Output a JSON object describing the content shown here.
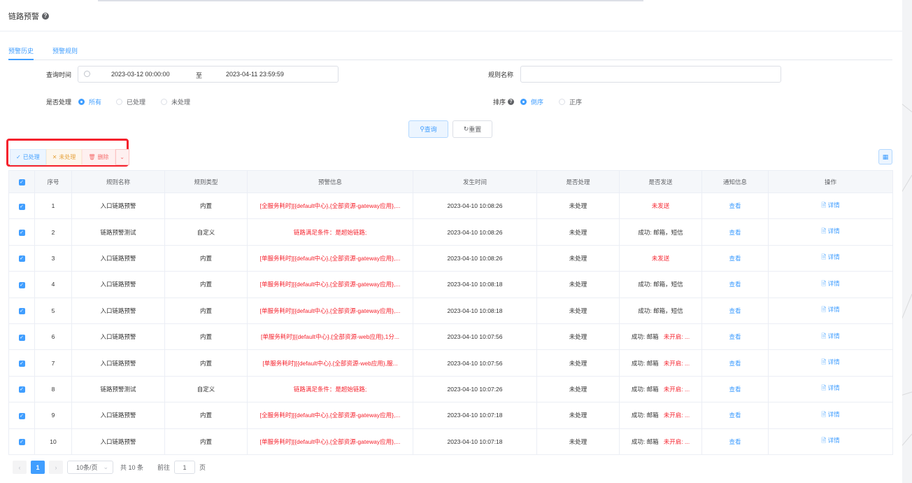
{
  "page": {
    "title": "链路预警"
  },
  "tabs": [
    {
      "label": "预警历史",
      "active": true
    },
    {
      "label": "预警规则",
      "active": false
    }
  ],
  "filters": {
    "time_label": "查询时间",
    "start": "2023-03-12 00:00:00",
    "separator": "至",
    "end": "2023-04-11 23:59:59",
    "rule_name_label": "规则名称",
    "rule_name_value": "",
    "processed_label": "是否处理",
    "processed_options": [
      "所有",
      "已处理",
      "未处理"
    ],
    "processed_selected": "所有",
    "sort_label": "排序",
    "sort_options": [
      "倒序",
      "正序"
    ],
    "sort_selected": "倒序"
  },
  "buttons": {
    "query": "查询",
    "reset": "重置"
  },
  "actions": {
    "processed": "已处理",
    "unprocessed": "未处理",
    "delete": "删除"
  },
  "columns": [
    "序号",
    "规则名称",
    "规则类型",
    "预警信息",
    "发生时间",
    "是否处理",
    "是否发送",
    "通知信息",
    "操作"
  ],
  "rows": [
    {
      "no": "1",
      "rule": "入口链路预警",
      "type": "内置",
      "info": "[全服务耗时][{default中心},{全部资源-gateway应用},...",
      "time": "2023-04-10 10:08:26",
      "processed": "未处理",
      "sent": "未发送",
      "notify": "查看",
      "op": "详情"
    },
    {
      "no": "2",
      "rule": "链路预警测试",
      "type": "自定义",
      "info": "链路满足条件：是超始链路;",
      "time": "2023-04-10 10:08:26",
      "processed": "未处理",
      "sent": "成功: 邮箱，短信",
      "notify": "查看",
      "op": "详情"
    },
    {
      "no": "3",
      "rule": "入口链路预警",
      "type": "内置",
      "info": "[单服务耗时][{default中心},{全部资源-gateway应用},...",
      "time": "2023-04-10 10:08:26",
      "processed": "未处理",
      "sent": "未发送",
      "notify": "查看",
      "op": "详情"
    },
    {
      "no": "4",
      "rule": "入口链路预警",
      "type": "内置",
      "info": "[单服务耗时][{default中心},{全部资源-gateway应用},...",
      "time": "2023-04-10 10:08:18",
      "processed": "未处理",
      "sent": "成功: 邮箱，短信",
      "notify": "查看",
      "op": "详情"
    },
    {
      "no": "5",
      "rule": "入口链路预警",
      "type": "内置",
      "info": "[单服务耗时][{default中心},{全部资源-gateway应用},...",
      "time": "2023-04-10 10:08:18",
      "processed": "未处理",
      "sent": "成功: 邮箱，短信",
      "notify": "查看",
      "op": "详情"
    },
    {
      "no": "6",
      "rule": "入口链路预警",
      "type": "内置",
      "info": "[单服务耗时][{default中心},{全部资源-web应用},1分...",
      "time": "2023-04-10 10:07:56",
      "processed": "未处理",
      "sent": "成功: 邮箱   未开启: ...",
      "notify": "查看",
      "op": "详情"
    },
    {
      "no": "7",
      "rule": "入口链路预警",
      "type": "内置",
      "info": "[单服务耗时][{default中心},{全部资源-web应用},服...",
      "time": "2023-04-10 10:07:56",
      "processed": "未处理",
      "sent": "成功: 邮箱   未开启: ...",
      "notify": "查看",
      "op": "详情"
    },
    {
      "no": "8",
      "rule": "链路预警测试",
      "type": "自定义",
      "info": "链路满足条件：是超始链路;",
      "time": "2023-04-10 10:07:26",
      "processed": "未处理",
      "sent": "成功: 邮箱   未开启: ...",
      "notify": "查看",
      "op": "详情"
    },
    {
      "no": "9",
      "rule": "入口链路预警",
      "type": "内置",
      "info": "[全服务耗时][{default中心},{全部资源-gateway应用},...",
      "time": "2023-04-10 10:07:18",
      "processed": "未处理",
      "sent": "成功: 邮箱   未开启: ...",
      "notify": "查看",
      "op": "详情"
    },
    {
      "no": "10",
      "rule": "入口链路预警",
      "type": "内置",
      "info": "[单服务耗时][{default中心},{全部资源-gateway应用},...",
      "time": "2023-04-10 10:07:18",
      "processed": "未处理",
      "sent": "成功: 邮箱   未开启: ...",
      "notify": "查看",
      "op": "详情"
    }
  ],
  "pagination": {
    "current": "1",
    "page_size": "10条/页",
    "total": "共 10 条",
    "goto_label": "前往",
    "goto_value": "1",
    "page_suffix": "页"
  },
  "colors": {
    "primary": "#409eff",
    "danger": "#f5222d",
    "warning": "#e6a23c"
  }
}
